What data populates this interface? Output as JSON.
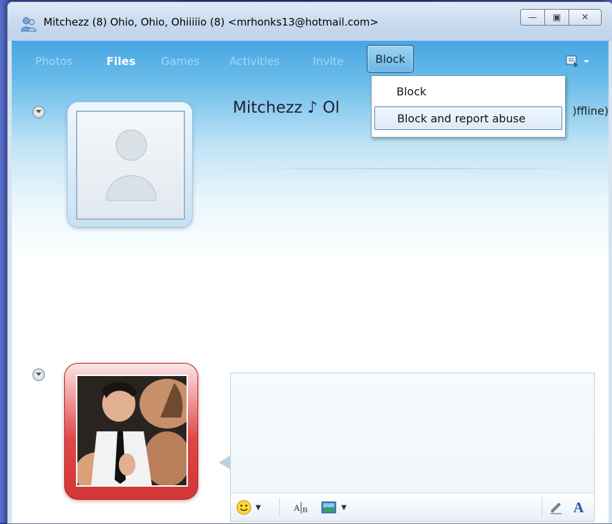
{
  "window": {
    "title": "Mitchezz (8) Ohio, Ohio, Ohiiiiio (8) <mrhonks13@hotmail.com>",
    "minimize_glyph": "—",
    "restore_glyph": "▣",
    "close_glyph": "✕"
  },
  "tabs": [
    {
      "label": "Photos",
      "active": false
    },
    {
      "label": "Files",
      "active": true
    },
    {
      "label": "Games",
      "active": false
    },
    {
      "label": "Activities",
      "active": false
    },
    {
      "label": "Invite",
      "active": false
    },
    {
      "label": "Block",
      "active": false
    }
  ],
  "block_menu": {
    "items": [
      {
        "label": "Block",
        "highlighted": false
      },
      {
        "label": "Block and report abuse",
        "highlighted": true
      }
    ]
  },
  "contact": {
    "name": "Mitchezz",
    "name_tail": "Ol",
    "music_note": "♪",
    "status_fragment": ")ffline)"
  },
  "toolbar": {
    "emoticon_icon": "smiley-icon",
    "winks_icon": "font-spelling-icon",
    "backgrounds_icon": "picture-icon",
    "handwriting_icon": "pen-icon",
    "font_icon": "font-a-icon",
    "font_label": "A"
  },
  "colors": {
    "accent": "#46a6e4",
    "my_frame": "#d23535",
    "contact_frame": "#c7e2f3"
  }
}
